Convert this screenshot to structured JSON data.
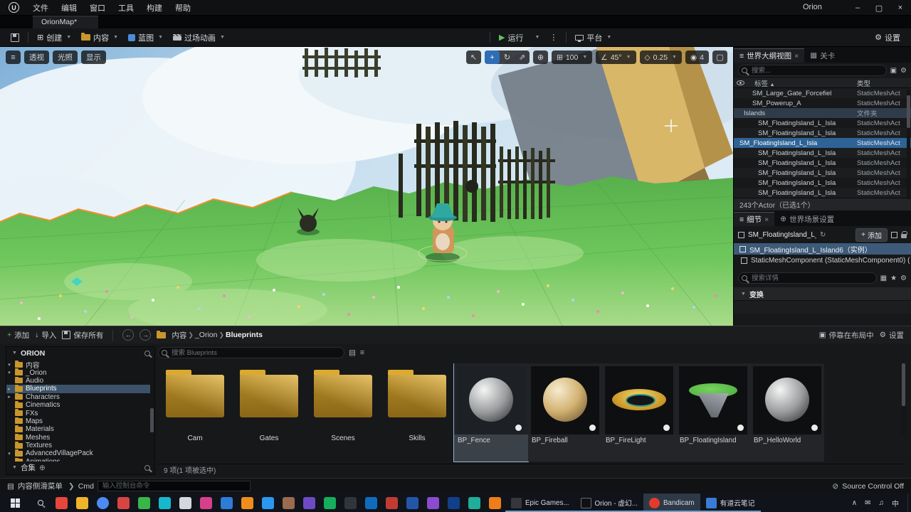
{
  "window": {
    "title": "Orion",
    "menu": [
      "文件",
      "编辑",
      "窗口",
      "工具",
      "构建",
      "帮助"
    ],
    "tab": "OrionMap*"
  },
  "toolbar": {
    "create": "创建",
    "content": "内容",
    "blueprint": "蓝图",
    "cinematics": "过场动画",
    "play": "运行",
    "platforms": "平台",
    "settings": "设置"
  },
  "viewport": {
    "perspective": "透视",
    "lit": "光照",
    "show": "显示",
    "grid_snap": "100",
    "angle_snap": "45°",
    "scale_snap": "0.25",
    "camera_speed": "4"
  },
  "outliner": {
    "tab_outliner": "世界大纲视图",
    "tab_levels": "关卡",
    "search_placeholder": "搜索...",
    "col_label": "标签",
    "col_type": "类型",
    "rows": [
      {
        "label": "SM_Large_Gate_Forcefiel",
        "type": "StaticMeshAct"
      },
      {
        "label": "SM_Powerup_A",
        "type": "StaticMeshAct"
      },
      {
        "label": "Islands",
        "type": "文件夹",
        "cls": "folderrow",
        "folder": true
      },
      {
        "label": "SM_FloatingIsland_L_Isla",
        "type": "StaticMeshAct",
        "cls": "child"
      },
      {
        "label": "SM_FloatingIsland_L_Isla",
        "type": "StaticMeshAct",
        "cls": "child"
      },
      {
        "label": "SM_FloatingIsland_L_Isla",
        "type": "StaticMeshAct",
        "cls": "selected",
        "eye": true
      },
      {
        "label": "SM_FloatingIsland_L_Isla",
        "type": "StaticMeshAct",
        "cls": "child"
      },
      {
        "label": "SM_FloatingIsland_L_Isla",
        "type": "StaticMeshAct",
        "cls": "child"
      },
      {
        "label": "SM_FloatingIsland_L_Isla",
        "type": "StaticMeshAct",
        "cls": "child"
      },
      {
        "label": "SM_FloatingIsland_L_Isla",
        "type": "StaticMeshAct",
        "cls": "child"
      },
      {
        "label": "SM_FloatingIsland_L_Isla",
        "type": "StaticMeshAct",
        "cls": "child"
      }
    ],
    "status": "243个Actor（已选1个）"
  },
  "details": {
    "tab_details": "细节",
    "tab_world": "世界场景设置",
    "header_name": "SM_FloatingIsland_L_I",
    "add_button": "添加",
    "instance": "SM_FloatingIsland_L_Island6（实例）",
    "component": "StaticMeshComponent (StaticMeshComponent0) (",
    "search_placeholder": "搜索详情",
    "section_transform": "变换"
  },
  "content_browser": {
    "add": "添加",
    "import": "导入",
    "save_all": "保存所有",
    "breadcrumb": [
      "内容",
      "_Orion",
      "Blueprints"
    ],
    "dock": "停靠在布局中",
    "settings": "设置",
    "sources_title": "ORION",
    "tree": [
      {
        "label": "内容",
        "lvl": "lv0",
        "arrow": "▾"
      },
      {
        "label": "_Orion",
        "lvl": "lv1",
        "arrow": "▾"
      },
      {
        "label": "Audio",
        "lvl": "lv2",
        "arrow": ""
      },
      {
        "label": "Blueprints",
        "lvl": "lv2",
        "arrow": "▸",
        "cls": "selected"
      },
      {
        "label": "Characters",
        "lvl": "lv2",
        "arrow": "▸"
      },
      {
        "label": "Cinematics",
        "lvl": "lv2",
        "arrow": ""
      },
      {
        "label": "FXs",
        "lvl": "lv2",
        "arrow": ""
      },
      {
        "label": "Maps",
        "lvl": "lv2",
        "arrow": ""
      },
      {
        "label": "Materials",
        "lvl": "lv2",
        "arrow": ""
      },
      {
        "label": "Meshes",
        "lvl": "lv2",
        "arrow": ""
      },
      {
        "label": "Textures",
        "lvl": "lv2",
        "arrow": ""
      },
      {
        "label": "AdvancedVillagePack",
        "lvl": "lv1",
        "arrow": "▾"
      },
      {
        "label": "Animations",
        "lvl": "lv2",
        "arrow": ""
      }
    ],
    "collections": "合集",
    "search_placeholder": "搜索 Blueprints",
    "folders": [
      {
        "label": "Cam"
      },
      {
        "label": "Gates"
      },
      {
        "label": "Scenes"
      },
      {
        "label": "Skills"
      }
    ],
    "assets": [
      {
        "label": "BP_Fence",
        "thumb": "sphere-gray",
        "cls": "selected"
      },
      {
        "label": "BP_Fireball",
        "thumb": "sphere-tan"
      },
      {
        "label": "BP_FireLight",
        "thumb": "ring-gold"
      },
      {
        "label": "BP_FloatingIsland",
        "thumb": "island"
      },
      {
        "label": "BP_HelloWorld",
        "thumb": "sphere-gray"
      }
    ],
    "status": "9 项(1 项被选中)"
  },
  "statusbar": {
    "drawer": "内容侧滑菜单",
    "cmd": "Cmd",
    "cmd_placeholder": "输入控制台命令",
    "source_control": "Source Control Off"
  },
  "taskbar": {
    "icons": [
      {
        "style": "background:#e8453c"
      },
      {
        "style": "background:#f0b429"
      },
      {
        "style": "background:#4c8bf5;border-radius:50%"
      },
      {
        "style": "background:#d64541"
      },
      {
        "style": "background:#3ab54a"
      },
      {
        "style": "background:#17b8ce"
      },
      {
        "style": "background:#d4d7dc"
      },
      {
        "style": "background:#d6408b"
      },
      {
        "style": "background:#2f7bd8"
      },
      {
        "style": "background:#f08c1e"
      },
      {
        "style": "background:#2b98f0"
      },
      {
        "style": "background:#9a6b4f"
      },
      {
        "style": "background:#6d4bc4"
      },
      {
        "style": "background:#14ae5c"
      },
      {
        "style": "background:#30343b"
      },
      {
        "style": "background:#0f6cbd"
      },
      {
        "style": "background:#c23b33"
      },
      {
        "style": "background:#2456a8"
      },
      {
        "style": "background:#8a4bd0"
      },
      {
        "style": "background:#123f8a"
      },
      {
        "style": "background:#1fae9a"
      },
      {
        "style": "background:#ef7d1a"
      }
    ],
    "apps": [
      {
        "label": "Epic Games...",
        "ico": "background:#35373c"
      },
      {
        "label": "Orion - 虚幻...",
        "ico": "background:#101114;border:1px solid #6a6e74"
      },
      {
        "label": "Bandicam",
        "ico": "background:#e23b2e;border-radius:50%",
        "cls": "active"
      },
      {
        "label": "有道云笔记",
        "ico": "background:#3a7bd5"
      }
    ],
    "tray": [
      "∧",
      "✉",
      "♫",
      "中"
    ]
  },
  "colors": {
    "accent_blue": "#2e6396",
    "play_green": "#5fc25f",
    "folder_yellow": "#c8962c",
    "selection_orange": "#ef8f2b"
  }
}
